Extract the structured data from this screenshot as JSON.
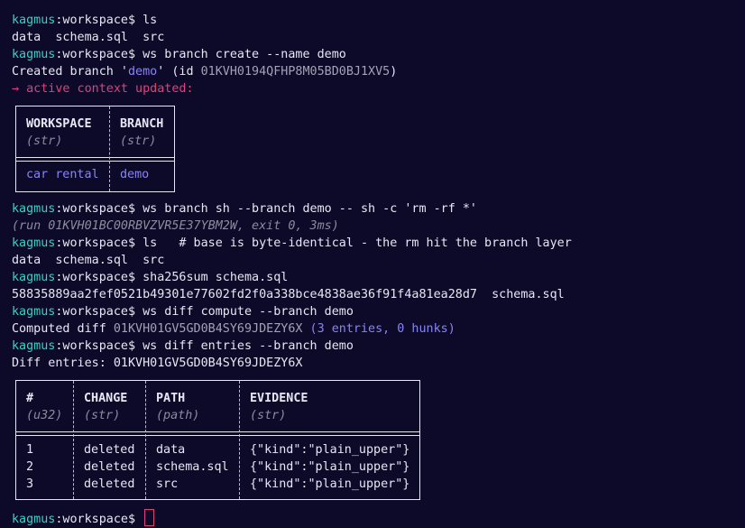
{
  "prompt": {
    "user": "kagmus",
    "path": ":workspace$ "
  },
  "lines": {
    "l1_cmd": "ls",
    "l2_out": "data  schema.sql  src",
    "l3_cmd": "ws branch create --name demo",
    "l4_a": "Created branch '",
    "l4_name": "demo",
    "l4_b": "' (id ",
    "l4_id": "01KVH0194QFHP8M05BD0BJ1XV5",
    "l4_c": ")",
    "l5_note": "→ active context updated:",
    "l6_cmd": "ws branch sh --branch demo -- sh -c 'rm -rf *'",
    "l7_run": "(run 01KVH01BC00RBVZVR5E37YBM2W, exit 0, 3ms)",
    "l8_cmd": "ls   # base is byte-identical - the rm hit the branch layer",
    "l9_out": "data  schema.sql  src",
    "l10_cmd": "sha256sum schema.sql",
    "l11_out": "58835889aa2fef0521b49301e77602fd2f0a338bce4838ae36f91f4a81ea28d7  schema.sql",
    "l12_cmd": "ws diff compute --branch demo",
    "l13_a": "Computed diff ",
    "l13_id": "01KVH01GV5GD0B4SY69JDEZY6X",
    "l13_b": " (3 entries, 0 hunks)",
    "l14_cmd": "ws diff entries --branch demo",
    "l15_out": "Diff entries: 01KVH01GV5GD0B4SY69JDEZY6X"
  },
  "context_table": {
    "headers": [
      "WORKSPACE",
      "BRANCH"
    ],
    "types": [
      "(str)",
      "(str)"
    ],
    "row": [
      "car rental",
      "demo"
    ]
  },
  "diff_table": {
    "headers": [
      "#",
      "CHANGE",
      "PATH",
      "EVIDENCE"
    ],
    "types": [
      "(u32)",
      "(str)",
      "(path)",
      "(str)"
    ],
    "rows": [
      [
        "1",
        "deleted",
        "data",
        "{\"kind\":\"plain_upper\"}"
      ],
      [
        "2",
        "deleted",
        "schema.sql",
        "{\"kind\":\"plain_upper\"}"
      ],
      [
        "3",
        "deleted",
        "src",
        "{\"kind\":\"plain_upper\"}"
      ]
    ]
  },
  "colors": {
    "background": "#0c0a28",
    "prompt_user": "#36d3c4",
    "accent_purple": "#8a84f3",
    "accent_pink": "#e0407e"
  }
}
